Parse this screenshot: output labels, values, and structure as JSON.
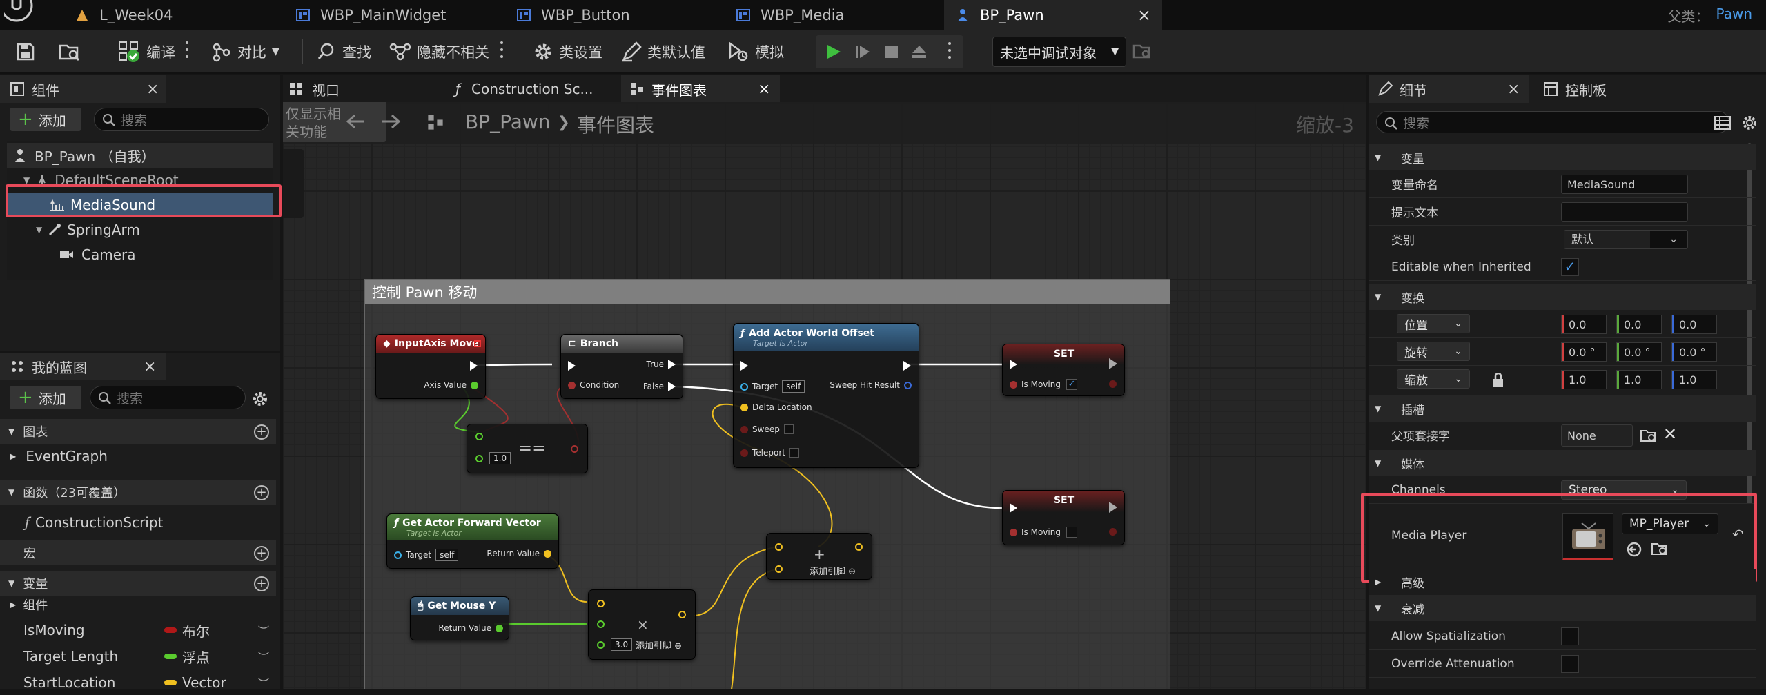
{
  "tabs": [
    {
      "label": "L_Week04"
    },
    {
      "label": "WBP_MainWidget"
    },
    {
      "label": "WBP_Button"
    },
    {
      "label": "WBP_Media"
    },
    {
      "label": "BP_Pawn",
      "close": "×"
    }
  ],
  "parent": {
    "label": "父类：",
    "value": "Pawn"
  },
  "toolbar": {
    "compile": "编译",
    "diff": "对比",
    "find": "查找",
    "hide": "隐藏不相关",
    "class_settings": "类设置",
    "class_defaults": "类默认值",
    "simulate": "模拟",
    "debug_target": "未选中调试对象"
  },
  "components": {
    "tab": "组件",
    "close": "×",
    "add": "添加",
    "search_placeholder": "搜索",
    "items": [
      "BP_Pawn （自我）",
      "DefaultSceneRoot",
      "MediaSound",
      "SpringArm",
      "Camera"
    ]
  },
  "myblueprint": {
    "tab": "我的蓝图",
    "close": "×",
    "add": "添加",
    "search_placeholder": "搜索",
    "graphs": "图表",
    "event_graph": "EventGraph",
    "functions": "函数（23可覆盖）",
    "construction": "ConstructionScript",
    "macros": "宏",
    "variables": "变量",
    "components": "组件",
    "vars": [
      {
        "name": "IsMoving",
        "type": "布尔",
        "color": "#b01818"
      },
      {
        "name": "Target Length",
        "type": "浮点",
        "color": "#5acb2e"
      },
      {
        "name": "StartLocation",
        "type": "Vector",
        "color": "#f0c020"
      }
    ]
  },
  "center_tabs": {
    "viewport": "视口",
    "construction": "Construction Sc...",
    "event_graph": "事件图表",
    "close": "×"
  },
  "graph": {
    "breadcrumb_root": "BP_Pawn",
    "breadcrumb_sep": "❯",
    "breadcrumb_leaf": "事件图表",
    "zoom": "缩放-3",
    "overlay_text": "仅显示相关功能",
    "comment": "控制 Pawn 移动",
    "nodes": {
      "input": {
        "title": "InputAxis Move",
        "axis": "Axis Value"
      },
      "branch": {
        "title": "Branch",
        "cond": "Condition",
        "true": "True",
        "false": "False"
      },
      "offset": {
        "title": "Add Actor World Offset",
        "sub": "Target is Actor",
        "target": "Target",
        "self": "self",
        "delta": "Delta Location",
        "sweep": "Sweep",
        "teleport": "Teleport",
        "hit": "Sweep Hit Result"
      },
      "set1": {
        "title": "SET",
        "var": "Is Moving"
      },
      "set2": {
        "title": "SET",
        "var": "Is Moving"
      },
      "eq": {
        "op": "==",
        "val": "1.0"
      },
      "fwd": {
        "title": "Get Actor Forward Vector",
        "sub": "Target is Actor",
        "target": "Target",
        "self": "self",
        "ret": "Return Value"
      },
      "mouse": {
        "title": "Get Mouse Y",
        "ret": "Return Value"
      },
      "add": {
        "op": "+",
        "pin": "添加引脚"
      },
      "mul": {
        "op": "×",
        "val": "3.0",
        "pin": "添加引脚"
      }
    }
  },
  "details": {
    "tab": "细节",
    "close": "×",
    "tab2": "控制板",
    "search_placeholder": "搜索",
    "sec_var": "变量",
    "var_name_label": "变量命名",
    "var_name": "MediaSound",
    "tooltip_label": "提示文本",
    "category_label": "类别",
    "category": "默认",
    "editable_label": "Editable when Inherited",
    "sec_transform": "变换",
    "loc": "位置",
    "rot": "旋转",
    "scale": "缩放",
    "loc_v": [
      "0.0",
      "0.0",
      "0.0"
    ],
    "rot_v": [
      "0.0 °",
      "0.0 °",
      "0.0 °"
    ],
    "scale_v": [
      "1.0",
      "1.0",
      "1.0"
    ],
    "sec_socket": "插槽",
    "parent_socket": "父项套接字",
    "socket_val": "None",
    "sec_media": "媒体",
    "channels": "Channels",
    "channels_val": "Stereo",
    "media_player": "Media Player",
    "mp_val": "MP_Player",
    "sec_adv": "高级",
    "sec_atten": "衰减",
    "allow_spat": "Allow Spatialization",
    "override_atten": "Override Attenuation"
  }
}
